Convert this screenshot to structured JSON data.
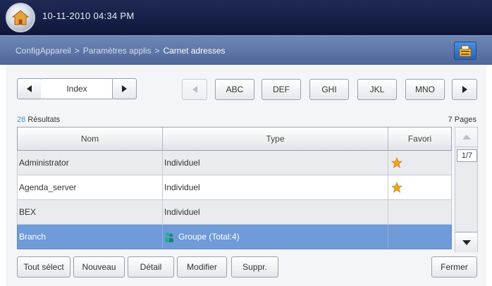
{
  "status": {
    "datetime": "10-11-2010 04:34 PM"
  },
  "breadcrumb": {
    "items": [
      "ConfigAppareil",
      "Paramètres applis",
      "Carnet adresses"
    ],
    "separator": ">"
  },
  "index_nav": {
    "label": "Index"
  },
  "letter_tabs": [
    "ABC",
    "DEF",
    "GHI",
    "JKL",
    "MNO"
  ],
  "results": {
    "count": "28",
    "label": " Résultats",
    "pages": "7 Pages"
  },
  "table": {
    "columns": [
      "Nom",
      "Type",
      "Favori"
    ],
    "rows": [
      {
        "name": "Administrator",
        "type": "Individuel",
        "favorite": true,
        "selected": false
      },
      {
        "name": "Agenda_server",
        "type": "Individuel",
        "favorite": true,
        "selected": false
      },
      {
        "name": "BEX",
        "type": "Individuel",
        "favorite": false,
        "selected": false
      },
      {
        "name": "Branch",
        "type": "Groupe (Total:4)",
        "favorite": false,
        "selected": true
      }
    ]
  },
  "pager": {
    "indicator": "1/7"
  },
  "actions": {
    "select_all": "Tout sélect",
    "new": "Nouveau",
    "detail": "Détail",
    "modify": "Modifier",
    "delete": "Suppr.",
    "close": "Fermer"
  },
  "colors": {
    "selected_row": "#6f9bd8",
    "star": "#f2a31b",
    "accent": "#4a8fd6"
  }
}
